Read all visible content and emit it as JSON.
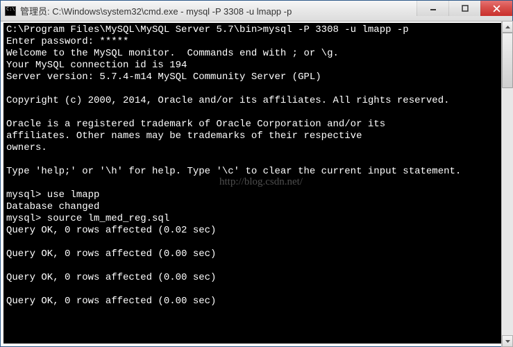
{
  "window": {
    "title": "管理员: C:\\Windows\\system32\\cmd.exe - mysql  -P 3308 -u lmapp -p"
  },
  "watermark": "http://blog.csdn.net/",
  "terminal": {
    "lines": [
      "C:\\Program Files\\MySQL\\MySQL Server 5.7\\bin>mysql -P 3308 -u lmapp -p",
      "Enter password: *****",
      "Welcome to the MySQL monitor.  Commands end with ; or \\g.",
      "Your MySQL connection id is 194",
      "Server version: 5.7.4-m14 MySQL Community Server (GPL)",
      "",
      "Copyright (c) 2000, 2014, Oracle and/or its affiliates. All rights reserved.",
      "",
      "Oracle is a registered trademark of Oracle Corporation and/or its",
      "affiliates. Other names may be trademarks of their respective",
      "owners.",
      "",
      "Type 'help;' or '\\h' for help. Type '\\c' to clear the current input statement.",
      "",
      "mysql> use lmapp",
      "Database changed",
      "mysql> source lm_med_reg.sql",
      "Query OK, 0 rows affected (0.02 sec)",
      "",
      "Query OK, 0 rows affected (0.00 sec)",
      "",
      "Query OK, 0 rows affected (0.00 sec)",
      "",
      "Query OK, 0 rows affected (0.00 sec)"
    ]
  }
}
